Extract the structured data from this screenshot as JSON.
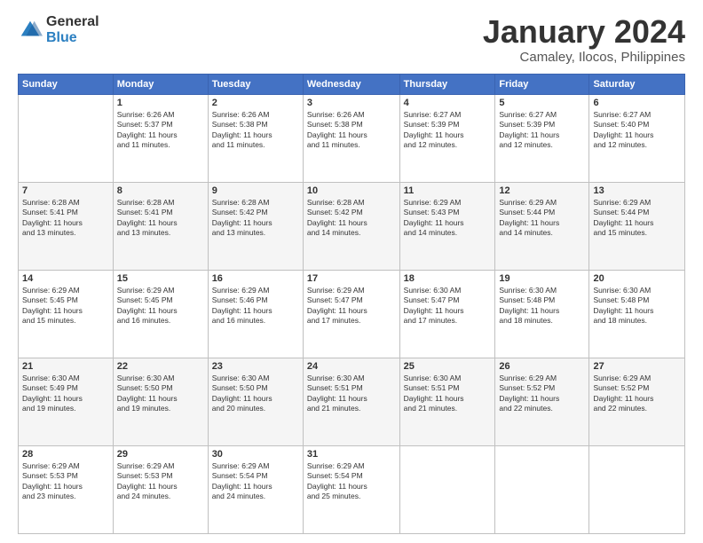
{
  "logo": {
    "general": "General",
    "blue": "Blue"
  },
  "title": "January 2024",
  "location": "Camaley, Ilocos, Philippines",
  "days_header": [
    "Sunday",
    "Monday",
    "Tuesday",
    "Wednesday",
    "Thursday",
    "Friday",
    "Saturday"
  ],
  "weeks": [
    [
      {
        "day": "",
        "info": ""
      },
      {
        "day": "1",
        "info": "Sunrise: 6:26 AM\nSunset: 5:37 PM\nDaylight: 11 hours\nand 11 minutes."
      },
      {
        "day": "2",
        "info": "Sunrise: 6:26 AM\nSunset: 5:38 PM\nDaylight: 11 hours\nand 11 minutes."
      },
      {
        "day": "3",
        "info": "Sunrise: 6:26 AM\nSunset: 5:38 PM\nDaylight: 11 hours\nand 11 minutes."
      },
      {
        "day": "4",
        "info": "Sunrise: 6:27 AM\nSunset: 5:39 PM\nDaylight: 11 hours\nand 12 minutes."
      },
      {
        "day": "5",
        "info": "Sunrise: 6:27 AM\nSunset: 5:39 PM\nDaylight: 11 hours\nand 12 minutes."
      },
      {
        "day": "6",
        "info": "Sunrise: 6:27 AM\nSunset: 5:40 PM\nDaylight: 11 hours\nand 12 minutes."
      }
    ],
    [
      {
        "day": "7",
        "info": "Sunrise: 6:28 AM\nSunset: 5:41 PM\nDaylight: 11 hours\nand 13 minutes."
      },
      {
        "day": "8",
        "info": "Sunrise: 6:28 AM\nSunset: 5:41 PM\nDaylight: 11 hours\nand 13 minutes."
      },
      {
        "day": "9",
        "info": "Sunrise: 6:28 AM\nSunset: 5:42 PM\nDaylight: 11 hours\nand 13 minutes."
      },
      {
        "day": "10",
        "info": "Sunrise: 6:28 AM\nSunset: 5:42 PM\nDaylight: 11 hours\nand 14 minutes."
      },
      {
        "day": "11",
        "info": "Sunrise: 6:29 AM\nSunset: 5:43 PM\nDaylight: 11 hours\nand 14 minutes."
      },
      {
        "day": "12",
        "info": "Sunrise: 6:29 AM\nSunset: 5:44 PM\nDaylight: 11 hours\nand 14 minutes."
      },
      {
        "day": "13",
        "info": "Sunrise: 6:29 AM\nSunset: 5:44 PM\nDaylight: 11 hours\nand 15 minutes."
      }
    ],
    [
      {
        "day": "14",
        "info": "Sunrise: 6:29 AM\nSunset: 5:45 PM\nDaylight: 11 hours\nand 15 minutes."
      },
      {
        "day": "15",
        "info": "Sunrise: 6:29 AM\nSunset: 5:45 PM\nDaylight: 11 hours\nand 16 minutes."
      },
      {
        "day": "16",
        "info": "Sunrise: 6:29 AM\nSunset: 5:46 PM\nDaylight: 11 hours\nand 16 minutes."
      },
      {
        "day": "17",
        "info": "Sunrise: 6:29 AM\nSunset: 5:47 PM\nDaylight: 11 hours\nand 17 minutes."
      },
      {
        "day": "18",
        "info": "Sunrise: 6:30 AM\nSunset: 5:47 PM\nDaylight: 11 hours\nand 17 minutes."
      },
      {
        "day": "19",
        "info": "Sunrise: 6:30 AM\nSunset: 5:48 PM\nDaylight: 11 hours\nand 18 minutes."
      },
      {
        "day": "20",
        "info": "Sunrise: 6:30 AM\nSunset: 5:48 PM\nDaylight: 11 hours\nand 18 minutes."
      }
    ],
    [
      {
        "day": "21",
        "info": "Sunrise: 6:30 AM\nSunset: 5:49 PM\nDaylight: 11 hours\nand 19 minutes."
      },
      {
        "day": "22",
        "info": "Sunrise: 6:30 AM\nSunset: 5:50 PM\nDaylight: 11 hours\nand 19 minutes."
      },
      {
        "day": "23",
        "info": "Sunrise: 6:30 AM\nSunset: 5:50 PM\nDaylight: 11 hours\nand 20 minutes."
      },
      {
        "day": "24",
        "info": "Sunrise: 6:30 AM\nSunset: 5:51 PM\nDaylight: 11 hours\nand 21 minutes."
      },
      {
        "day": "25",
        "info": "Sunrise: 6:30 AM\nSunset: 5:51 PM\nDaylight: 11 hours\nand 21 minutes."
      },
      {
        "day": "26",
        "info": "Sunrise: 6:29 AM\nSunset: 5:52 PM\nDaylight: 11 hours\nand 22 minutes."
      },
      {
        "day": "27",
        "info": "Sunrise: 6:29 AM\nSunset: 5:52 PM\nDaylight: 11 hours\nand 22 minutes."
      }
    ],
    [
      {
        "day": "28",
        "info": "Sunrise: 6:29 AM\nSunset: 5:53 PM\nDaylight: 11 hours\nand 23 minutes."
      },
      {
        "day": "29",
        "info": "Sunrise: 6:29 AM\nSunset: 5:53 PM\nDaylight: 11 hours\nand 24 minutes."
      },
      {
        "day": "30",
        "info": "Sunrise: 6:29 AM\nSunset: 5:54 PM\nDaylight: 11 hours\nand 24 minutes."
      },
      {
        "day": "31",
        "info": "Sunrise: 6:29 AM\nSunset: 5:54 PM\nDaylight: 11 hours\nand 25 minutes."
      },
      {
        "day": "",
        "info": ""
      },
      {
        "day": "",
        "info": ""
      },
      {
        "day": "",
        "info": ""
      }
    ]
  ]
}
